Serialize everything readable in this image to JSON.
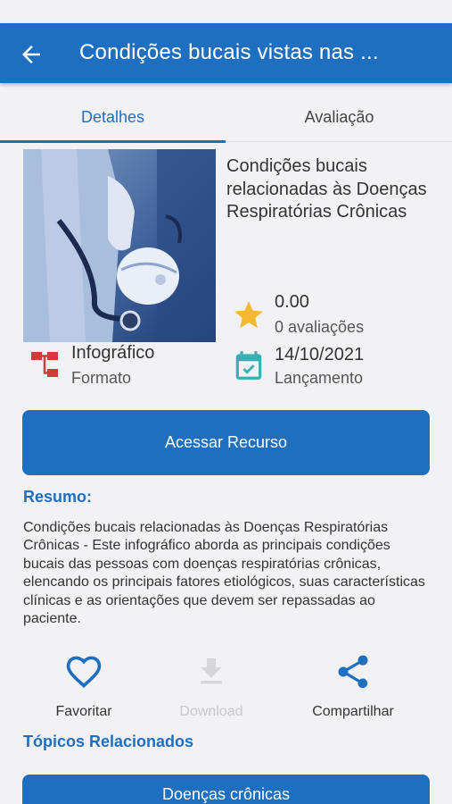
{
  "appbar": {
    "title": "Condições bucais vistas nas ...",
    "back_icon": "arrow-left-icon",
    "background": "#1f6fc1"
  },
  "tabs": [
    {
      "label": "Detalhes",
      "active": true
    },
    {
      "label": "Avaliação",
      "active": false
    }
  ],
  "resource": {
    "title": "Condições bucais relacionadas às Doenças Respiratórias Crônicas",
    "rating": {
      "value": "0.00",
      "count": "0 avaliações",
      "icon": "star-icon",
      "color": "#f5b82e"
    },
    "format": {
      "value": "Infográfico",
      "label": "Formato",
      "icon": "infographic-icon",
      "color": "#d23a3a"
    },
    "release": {
      "value": "14/10/2021",
      "label": "Lançamento",
      "icon": "calendar-check-icon",
      "color": "#3aaeb5"
    }
  },
  "access_button": {
    "label": "Acessar Recurso"
  },
  "summary": {
    "title": "Resumo:",
    "text": "Condições bucais relacionadas às Doenças Respiratórias Crônicas - Este infográfico aborda as principais condições bucais das pessoas com doenças respiratórias crônicas, elencando os principais fatores etiológicos, suas características clínicas e as orientações que devem ser repassadas ao paciente."
  },
  "actions": [
    {
      "label": "Favoritar",
      "icon": "heart-outline-icon",
      "enabled": true
    },
    {
      "label": "Download",
      "icon": "download-icon",
      "enabled": false
    },
    {
      "label": "Compartilhar",
      "icon": "share-icon",
      "enabled": true
    }
  ],
  "related_topics": {
    "title": "Tópicos Relacionados",
    "items": [
      "Doenças crônicas"
    ]
  },
  "accent_color": "#1f6fc1"
}
